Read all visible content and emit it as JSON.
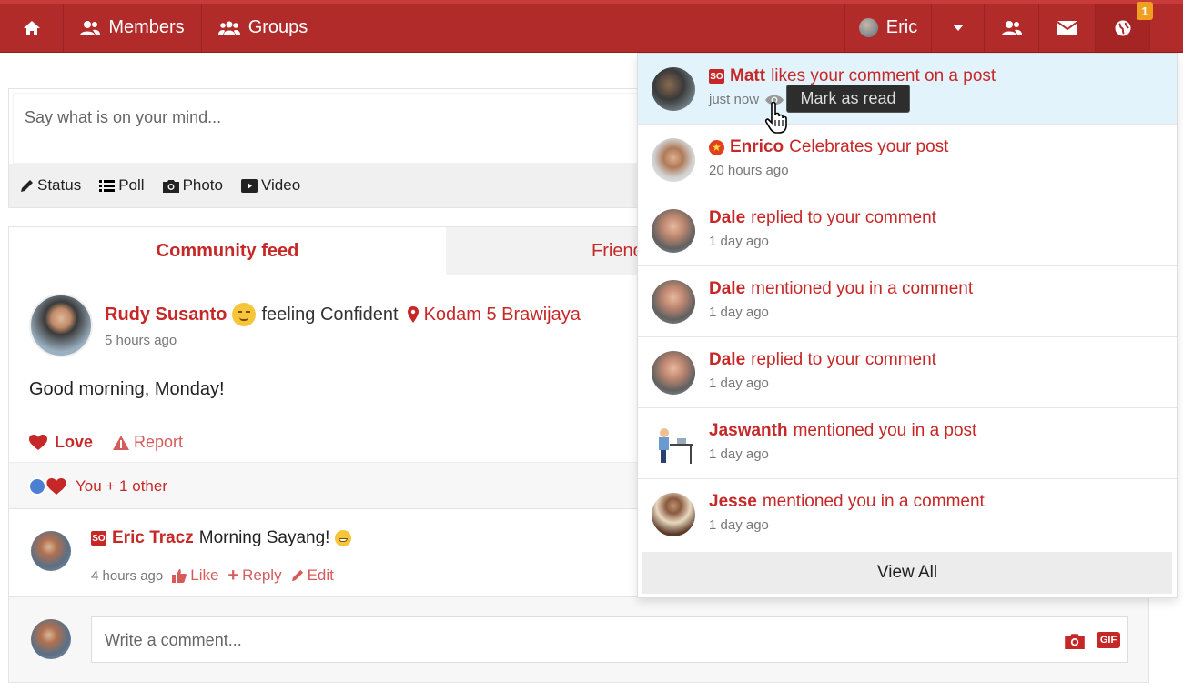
{
  "nav": {
    "members_label": "Members",
    "groups_label": "Groups",
    "user_name": "Eric",
    "notification_count": "1"
  },
  "composer": {
    "placeholder": "Say what is on your mind...",
    "tools": [
      "Status",
      "Poll",
      "Photo",
      "Video"
    ]
  },
  "feed": {
    "tabs": [
      "Community feed",
      "Friends"
    ],
    "post": {
      "author": "Rudy Susanto",
      "feeling": "feeling Confident",
      "location": "Kodam 5 Brawijaya",
      "time": "5 hours ago",
      "body": "Good morning, Monday!",
      "love_label": "Love",
      "report_label": "Report",
      "reactions_text": "You + 1 other"
    },
    "comment": {
      "author": "Eric Tracz",
      "text": "Morning Sayang!",
      "time": "4 hours ago",
      "like_label": "Like",
      "reply_label": "Reply",
      "edit_label": "Edit"
    },
    "comment_input": {
      "placeholder": "Write a comment..."
    }
  },
  "notifications": {
    "items": [
      {
        "name": "Matt",
        "text": "likes your comment on a post",
        "time": "just now"
      },
      {
        "name": "Enrico",
        "text": "Celebrates your post",
        "time": "20 hours ago"
      },
      {
        "name": "Dale",
        "text": "replied to your comment",
        "time": "1 day ago"
      },
      {
        "name": "Dale",
        "text": "mentioned you in a comment",
        "time": "1 day ago"
      },
      {
        "name": "Dale",
        "text": "replied to your comment",
        "time": "1 day ago"
      },
      {
        "name": "Jaswanth",
        "text": "mentioned you in a post",
        "time": "1 day ago"
      },
      {
        "name": "Jesse",
        "text": "mentioned you in a comment",
        "time": "1 day ago"
      }
    ],
    "view_all_label": "View All",
    "tooltip": "Mark as read"
  },
  "colors": {
    "brand": "#b22b2b",
    "accent": "#c62828",
    "highlight": "#e3f3fb"
  }
}
